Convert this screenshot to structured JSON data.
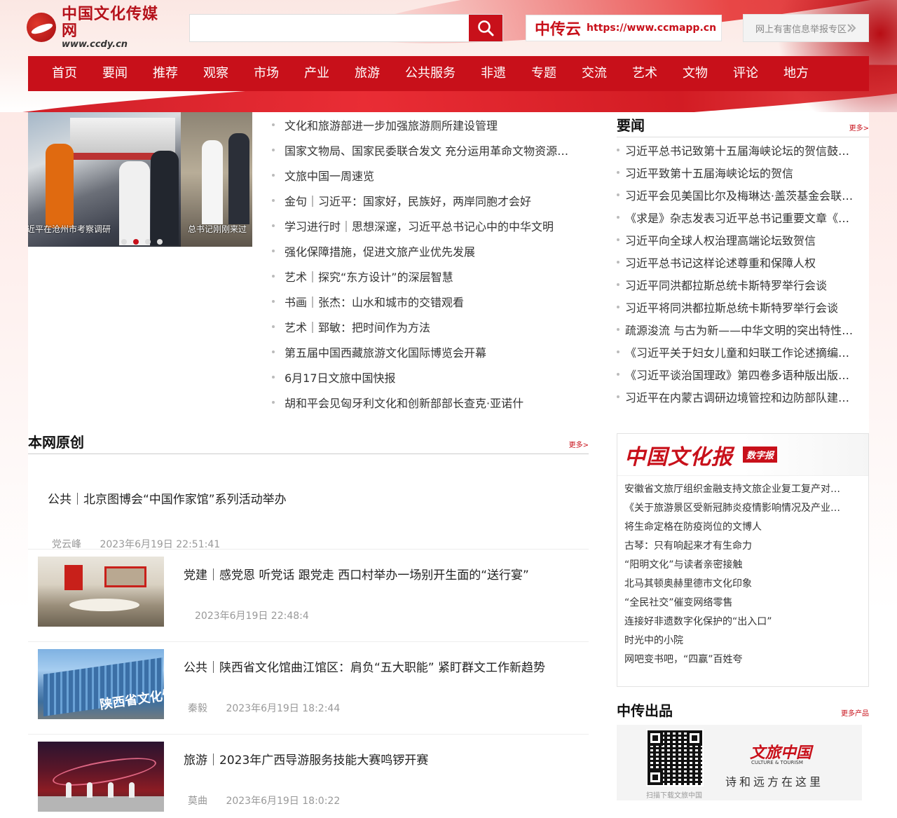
{
  "header": {
    "logo_cn": "中国文化传媒网",
    "logo_url": "www.ccdy.cn",
    "search_placeholder": "",
    "cc_name": "中传云",
    "cc_url": "https://www.ccmapp.cn",
    "report_label": "网上有害信息举报专区"
  },
  "nav": [
    "首页",
    "要闻",
    "推荐",
    "观察",
    "市场",
    "产业",
    "旅游",
    "公共服务",
    "非遗",
    "专题",
    "交流",
    "艺术",
    "文物",
    "评论",
    "地方"
  ],
  "slider": {
    "captions": [
      "近平在沧州市考察调研",
      "总书记刚刚来过"
    ],
    "dot_count": 4,
    "active_dot": 1
  },
  "headlines": [
    "文化和旅游部进一步加强旅游厕所建设管理",
    "国家文物局、国家民委联合发文 充分运用革命文物资源…",
    "文旅中国一周速览",
    "金句｜习近平：国家好，民族好，两岸同胞才会好",
    "学习进行时｜思想深邃，习近平总书记心中的中华文明",
    "强化保障措施，促进文旅产业优先发展",
    "艺术｜探究“东方设计”的深层智慧",
    "书画｜张杰：山水和城市的交错观看",
    "艺术｜郅敏：把时间作为方法",
    "第五届中国西藏旅游文化国际博览会开幕",
    "6月17日文旅中国快报",
    "胡和平会见匈牙利文化和创新部部长查克·亚诺什"
  ],
  "yaowen": {
    "title": "要闻",
    "more": "更多>",
    "items": [
      "习近平总书记致第十五届海峡论坛的贺信鼓…",
      "习近平致第十五届海峡论坛的贺信",
      "习近平会见美国比尔及梅琳达·盖茨基金会联…",
      "《求是》杂志发表习近平总书记重要文章《…",
      "习近平向全球人权治理高端论坛致贺信",
      "习近平总书记这样论述尊重和保障人权",
      "习近平同洪都拉斯总统卡斯特罗举行会谈",
      "习近平将同洪都拉斯总统卡斯特罗举行会谈",
      "疏源浚流 与古为新——中华文明的突出特性…",
      "《习近平关于妇女儿童和妇联工作论述摘编…",
      "《习近平谈治国理政》第四卷多语种版出版…",
      "习近平在内蒙古调研边境管控和边防部队建…"
    ]
  },
  "original": {
    "title": "本网原创",
    "more": "更多>",
    "first": {
      "title": "公共｜北京图博会“中国作家馆”系列活动举办",
      "author": "党云峰",
      "time": "2023年6月19日 22:51:41"
    },
    "rows": [
      {
        "title": "党建｜感党恩 听党话 跟党走 西口村举办一场别开生面的“送行宴”",
        "author": "",
        "time": "2023年6月19日 22:48:4"
      },
      {
        "title": "公共｜陕西省文化馆曲江馆区：肩负“五大职能” 紧盯群文工作新趋势",
        "author": "秦毅",
        "time": "2023年6月19日 18:2:44"
      },
      {
        "title": "旅游｜2023年广西导游服务技能大赛鸣锣开赛",
        "author": "莫曲",
        "time": "2023年6月19日 18:0:22"
      }
    ],
    "thumb2_sign": "陕西省文化馆"
  },
  "paper": {
    "logo": "中国文化报",
    "tag": "数字报",
    "items": [
      "安徽省文旅厅组织金融支持文旅企业复工复产对…",
      "《关于旅游景区受新冠肺炎疫情影响情况及产业…",
      "将生命定格在防疫岗位的文博人",
      "古琴：只有响起来才有生命力",
      "“阳明文化”与读者亲密接触",
      "北马其顿奥赫里德市文化印象",
      "“全民社交”催变网络零售",
      "连接好非遗数字化保护的“出入口”",
      "时光中的小院",
      "网吧变书吧，“四赢”百姓夸"
    ]
  },
  "products": {
    "title": "中传出品",
    "more": "更多产品",
    "qr_caption": "扫描下载文旅中国",
    "brand_cn": "文旅中国",
    "brand_en": "CULTURE & TOURISM",
    "slogan": "诗和远方在这里"
  },
  "colors": {
    "brand_red": "#c8101a"
  }
}
